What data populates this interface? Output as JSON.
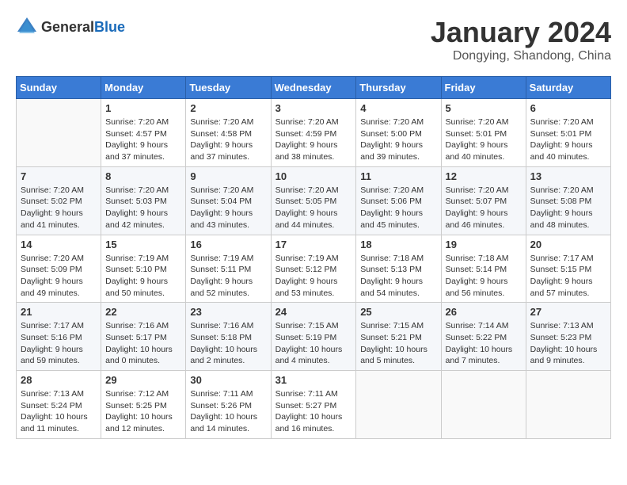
{
  "header": {
    "logo_general": "General",
    "logo_blue": "Blue",
    "month_title": "January 2024",
    "location": "Dongying, Shandong, China"
  },
  "days_of_week": [
    "Sunday",
    "Monday",
    "Tuesday",
    "Wednesday",
    "Thursday",
    "Friday",
    "Saturday"
  ],
  "weeks": [
    [
      {
        "day": "",
        "sunrise": "",
        "sunset": "",
        "daylight": ""
      },
      {
        "day": "1",
        "sunrise": "Sunrise: 7:20 AM",
        "sunset": "Sunset: 4:57 PM",
        "daylight": "Daylight: 9 hours and 37 minutes."
      },
      {
        "day": "2",
        "sunrise": "Sunrise: 7:20 AM",
        "sunset": "Sunset: 4:58 PM",
        "daylight": "Daylight: 9 hours and 37 minutes."
      },
      {
        "day": "3",
        "sunrise": "Sunrise: 7:20 AM",
        "sunset": "Sunset: 4:59 PM",
        "daylight": "Daylight: 9 hours and 38 minutes."
      },
      {
        "day": "4",
        "sunrise": "Sunrise: 7:20 AM",
        "sunset": "Sunset: 5:00 PM",
        "daylight": "Daylight: 9 hours and 39 minutes."
      },
      {
        "day": "5",
        "sunrise": "Sunrise: 7:20 AM",
        "sunset": "Sunset: 5:01 PM",
        "daylight": "Daylight: 9 hours and 40 minutes."
      },
      {
        "day": "6",
        "sunrise": "Sunrise: 7:20 AM",
        "sunset": "Sunset: 5:01 PM",
        "daylight": "Daylight: 9 hours and 40 minutes."
      }
    ],
    [
      {
        "day": "7",
        "sunrise": "Sunrise: 7:20 AM",
        "sunset": "Sunset: 5:02 PM",
        "daylight": "Daylight: 9 hours and 41 minutes."
      },
      {
        "day": "8",
        "sunrise": "Sunrise: 7:20 AM",
        "sunset": "Sunset: 5:03 PM",
        "daylight": "Daylight: 9 hours and 42 minutes."
      },
      {
        "day": "9",
        "sunrise": "Sunrise: 7:20 AM",
        "sunset": "Sunset: 5:04 PM",
        "daylight": "Daylight: 9 hours and 43 minutes."
      },
      {
        "day": "10",
        "sunrise": "Sunrise: 7:20 AM",
        "sunset": "Sunset: 5:05 PM",
        "daylight": "Daylight: 9 hours and 44 minutes."
      },
      {
        "day": "11",
        "sunrise": "Sunrise: 7:20 AM",
        "sunset": "Sunset: 5:06 PM",
        "daylight": "Daylight: 9 hours and 45 minutes."
      },
      {
        "day": "12",
        "sunrise": "Sunrise: 7:20 AM",
        "sunset": "Sunset: 5:07 PM",
        "daylight": "Daylight: 9 hours and 46 minutes."
      },
      {
        "day": "13",
        "sunrise": "Sunrise: 7:20 AM",
        "sunset": "Sunset: 5:08 PM",
        "daylight": "Daylight: 9 hours and 48 minutes."
      }
    ],
    [
      {
        "day": "14",
        "sunrise": "Sunrise: 7:20 AM",
        "sunset": "Sunset: 5:09 PM",
        "daylight": "Daylight: 9 hours and 49 minutes."
      },
      {
        "day": "15",
        "sunrise": "Sunrise: 7:19 AM",
        "sunset": "Sunset: 5:10 PM",
        "daylight": "Daylight: 9 hours and 50 minutes."
      },
      {
        "day": "16",
        "sunrise": "Sunrise: 7:19 AM",
        "sunset": "Sunset: 5:11 PM",
        "daylight": "Daylight: 9 hours and 52 minutes."
      },
      {
        "day": "17",
        "sunrise": "Sunrise: 7:19 AM",
        "sunset": "Sunset: 5:12 PM",
        "daylight": "Daylight: 9 hours and 53 minutes."
      },
      {
        "day": "18",
        "sunrise": "Sunrise: 7:18 AM",
        "sunset": "Sunset: 5:13 PM",
        "daylight": "Daylight: 9 hours and 54 minutes."
      },
      {
        "day": "19",
        "sunrise": "Sunrise: 7:18 AM",
        "sunset": "Sunset: 5:14 PM",
        "daylight": "Daylight: 9 hours and 56 minutes."
      },
      {
        "day": "20",
        "sunrise": "Sunrise: 7:17 AM",
        "sunset": "Sunset: 5:15 PM",
        "daylight": "Daylight: 9 hours and 57 minutes."
      }
    ],
    [
      {
        "day": "21",
        "sunrise": "Sunrise: 7:17 AM",
        "sunset": "Sunset: 5:16 PM",
        "daylight": "Daylight: 9 hours and 59 minutes."
      },
      {
        "day": "22",
        "sunrise": "Sunrise: 7:16 AM",
        "sunset": "Sunset: 5:17 PM",
        "daylight": "Daylight: 10 hours and 0 minutes."
      },
      {
        "day": "23",
        "sunrise": "Sunrise: 7:16 AM",
        "sunset": "Sunset: 5:18 PM",
        "daylight": "Daylight: 10 hours and 2 minutes."
      },
      {
        "day": "24",
        "sunrise": "Sunrise: 7:15 AM",
        "sunset": "Sunset: 5:19 PM",
        "daylight": "Daylight: 10 hours and 4 minutes."
      },
      {
        "day": "25",
        "sunrise": "Sunrise: 7:15 AM",
        "sunset": "Sunset: 5:21 PM",
        "daylight": "Daylight: 10 hours and 5 minutes."
      },
      {
        "day": "26",
        "sunrise": "Sunrise: 7:14 AM",
        "sunset": "Sunset: 5:22 PM",
        "daylight": "Daylight: 10 hours and 7 minutes."
      },
      {
        "day": "27",
        "sunrise": "Sunrise: 7:13 AM",
        "sunset": "Sunset: 5:23 PM",
        "daylight": "Daylight: 10 hours and 9 minutes."
      }
    ],
    [
      {
        "day": "28",
        "sunrise": "Sunrise: 7:13 AM",
        "sunset": "Sunset: 5:24 PM",
        "daylight": "Daylight: 10 hours and 11 minutes."
      },
      {
        "day": "29",
        "sunrise": "Sunrise: 7:12 AM",
        "sunset": "Sunset: 5:25 PM",
        "daylight": "Daylight: 10 hours and 12 minutes."
      },
      {
        "day": "30",
        "sunrise": "Sunrise: 7:11 AM",
        "sunset": "Sunset: 5:26 PM",
        "daylight": "Daylight: 10 hours and 14 minutes."
      },
      {
        "day": "31",
        "sunrise": "Sunrise: 7:11 AM",
        "sunset": "Sunset: 5:27 PM",
        "daylight": "Daylight: 10 hours and 16 minutes."
      },
      {
        "day": "",
        "sunrise": "",
        "sunset": "",
        "daylight": ""
      },
      {
        "day": "",
        "sunrise": "",
        "sunset": "",
        "daylight": ""
      },
      {
        "day": "",
        "sunrise": "",
        "sunset": "",
        "daylight": ""
      }
    ]
  ]
}
